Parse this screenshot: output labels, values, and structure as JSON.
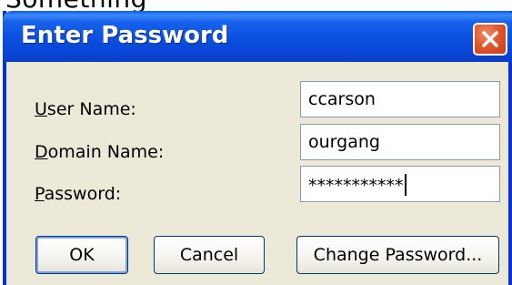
{
  "background_text": "Something",
  "window": {
    "title": "Enter Password",
    "close_icon": "close-x-icon",
    "titlebar_color": "#0a4fe0",
    "close_color": "#e2592e"
  },
  "form": {
    "user_name": {
      "label_accel": "U",
      "label_rest": "ser Name:",
      "value": "ccarson"
    },
    "domain_name": {
      "label_accel": "D",
      "label_rest": "omain Name:",
      "value": "ourgang"
    },
    "password": {
      "label_accel": "P",
      "label_rest": "assword:",
      "value": "***********"
    }
  },
  "buttons": {
    "ok": "OK",
    "cancel": "Cancel",
    "change_password": "Change Password..."
  }
}
